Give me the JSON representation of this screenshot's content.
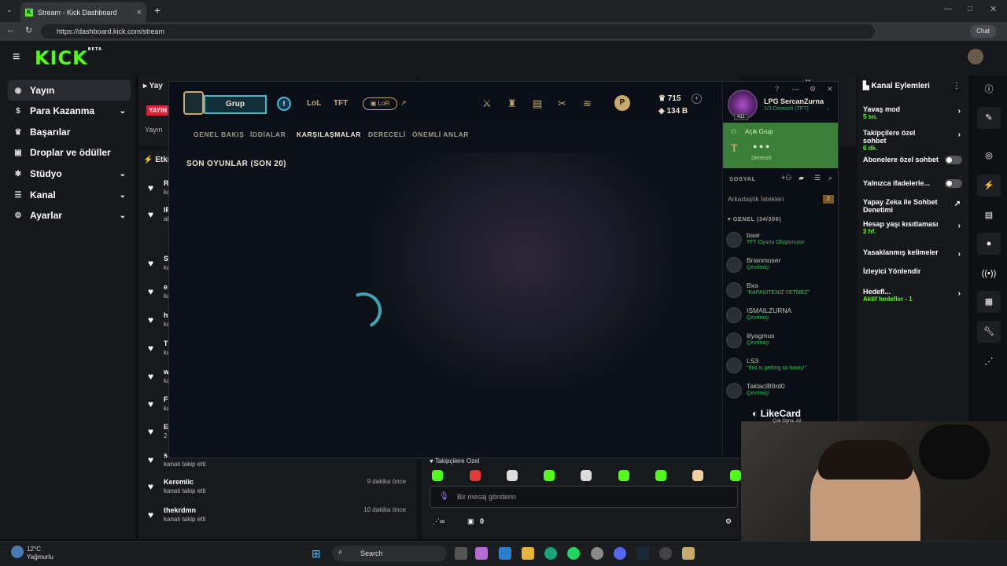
{
  "browser": {
    "tab_title": "Stream - Kick Dashboard",
    "url": "https://dashboard.kick.com/stream",
    "chat_label": "Chat"
  },
  "kick": {
    "logo": "KICK",
    "logo_badge": "BETA",
    "sidebar": [
      {
        "label": "Yayın",
        "icon": "broadcast-icon",
        "active": true
      },
      {
        "label": "Para Kazanma",
        "icon": "money-icon",
        "chevron": true
      },
      {
        "label": "Başarılar",
        "icon": "trophy-icon"
      },
      {
        "label": "Droplar ve ödüller",
        "icon": "gift-icon"
      },
      {
        "label": "Stüdyo",
        "icon": "gear-icon",
        "chevron": true
      },
      {
        "label": "Kanal",
        "icon": "people-icon",
        "chevron": true
      },
      {
        "label": "Ayarlar",
        "icon": "settings-icon",
        "chevron": true
      }
    ],
    "stream_panel": {
      "title_fragment": "Yay",
      "live_badge": "YAYIN",
      "sub_fragment": "Yayın",
      "activity_fragment": "Etki",
      "right_fragment": "Yayın"
    },
    "activity": [
      {
        "name": "R",
        "sub": "ka"
      },
      {
        "name": "IR",
        "sub": "ab"
      },
      {
        "name": "S",
        "sub": "ka"
      },
      {
        "name": "e",
        "sub": "ka"
      },
      {
        "name": "h",
        "sub": "ka"
      },
      {
        "name": "T",
        "sub": "ka"
      },
      {
        "name": "w",
        "sub": "ka"
      },
      {
        "name": "F",
        "sub": "ka"
      },
      {
        "name": "E",
        "sub": "2"
      },
      {
        "name": "s",
        "sub": "kanalı takip etti"
      },
      {
        "name": "Keremlic",
        "sub": "kanalı takip etti",
        "time": "9 dakika önce"
      },
      {
        "name": "thekrdmn",
        "sub": "kanalı takip etti",
        "time": "10 dakika önce"
      }
    ],
    "channel_actions": {
      "title": "Kanal Eylemleri",
      "items": [
        {
          "label": "Yavaş mod",
          "value": "5 sn.",
          "type": "arrow"
        },
        {
          "label": "Takipçilere özel sohbet",
          "value": "6 dk.",
          "type": "arrow"
        },
        {
          "label": "Abonelere özel sohbet",
          "value": "",
          "type": "toggle"
        },
        {
          "label": "Yalnızca ifadelerle...",
          "value": "",
          "type": "toggle"
        },
        {
          "label": "Yapay Zeka ile Sohbet Denetimi",
          "value": "",
          "type": "external"
        },
        {
          "label": "Hesap yaşı kısıtlaması",
          "value": "2 hf.",
          "type": "arrow"
        },
        {
          "label": "Yasaklanmış kelimeler",
          "value": "",
          "type": "arrow"
        },
        {
          "label": "İzleyici Yönlendir",
          "value": "",
          "type": "none"
        },
        {
          "label": "Hedefl...",
          "value": "Aktif hedefler - 1",
          "type": "arrow"
        }
      ]
    },
    "chat": {
      "followers_only": "Takipçilere Özel",
      "placeholder": "Bir mesaj gönderin",
      "count": "0"
    }
  },
  "lol": {
    "group_button": "Grup",
    "modes": [
      "LoL",
      "TFT",
      "LoR"
    ],
    "tabs": [
      "GENEL BAKIŞ",
      "İDDİALAR",
      "KARŞILAŞMALAR",
      "DERECELİ",
      "ÖNEMLİ ANLAR"
    ],
    "selected_tab": "KARŞILAŞMALAR",
    "recent_games": "SON OYUNLAR (SON 20)",
    "currency": {
      "be": "715",
      "rp": "134 B"
    },
    "profile": {
      "name": "LPG SercanZurna",
      "status": "1/3 Dereceli (TFT)",
      "level": "411"
    },
    "open_group": {
      "title": "Açık Grup",
      "sub": "Dereceli"
    },
    "social_label": "SOSYAL",
    "friend_requests": "Arkadaşlık İstekleri",
    "friend_requests_count": "2",
    "general_group": "GENEL (34/308)",
    "friends": [
      {
        "name": "baar",
        "status": "TFT Oyunu Oluşturuyor"
      },
      {
        "name": "Brianmoser",
        "status": "Çevrimiçi"
      },
      {
        "name": "Bxa",
        "status": "\"KAPASITENIZ YETMEZ\""
      },
      {
        "name": "ISMAILZURNA",
        "status": "Çevrimiçi"
      },
      {
        "name": "lilyagmus",
        "status": "Çevrimiçi"
      },
      {
        "name": "LS3",
        "status": "\"this is getting so funny!\""
      },
      {
        "name": "TaklaclB0rd0",
        "status": "Çevrimiçi"
      }
    ]
  },
  "overlay": {
    "likecard": "LikeCard",
    "likecard_sub": "Çok Oyna, Az"
  },
  "taskbar": {
    "temp": "12°C",
    "weather": "Yağmurlu",
    "search": "Search"
  },
  "colors": {
    "kick_green": "#53fc18",
    "lol_gold": "#c8aa6e",
    "lol_teal": "#3fa6b5"
  }
}
